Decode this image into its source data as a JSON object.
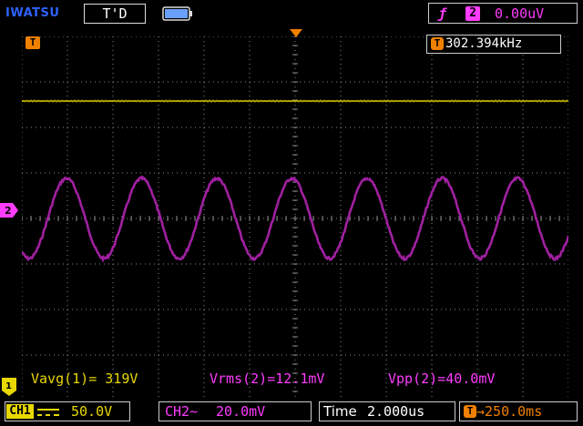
{
  "header": {
    "brand": "IWATSU",
    "trigger_state": "T'D",
    "trigger_slope_icon": "rising-edge-icon",
    "trigger_source": "2",
    "trigger_level": "0.00uV"
  },
  "markers": {
    "trigger_position": "T",
    "ch1_ground": "1",
    "ch2_ground": "2"
  },
  "frequency": {
    "icon": "T",
    "value": "302.394kHz"
  },
  "measurements": {
    "ch1_avg": "Vavg(1)= 319V",
    "ch2_rms": "Vrms(2)=12.1mV",
    "ch2_pp": "Vpp(2)=40.0mV"
  },
  "footer": {
    "ch1_tag": "CH1",
    "ch1_coupling": "DC",
    "ch1_scale": "50.0V",
    "ch2_tag": "CH2~",
    "ch2_scale": "20.0mV",
    "time_label": "Time",
    "time_scale": "2.000us",
    "delay_icon": "T",
    "delay_value": "→250.0ms"
  },
  "colors": {
    "ch1": "#e8d800",
    "ch2": "#a020a0",
    "trigger": "#f08000",
    "grid": "#8a8a8a",
    "accent": "#ff3cff"
  }
}
